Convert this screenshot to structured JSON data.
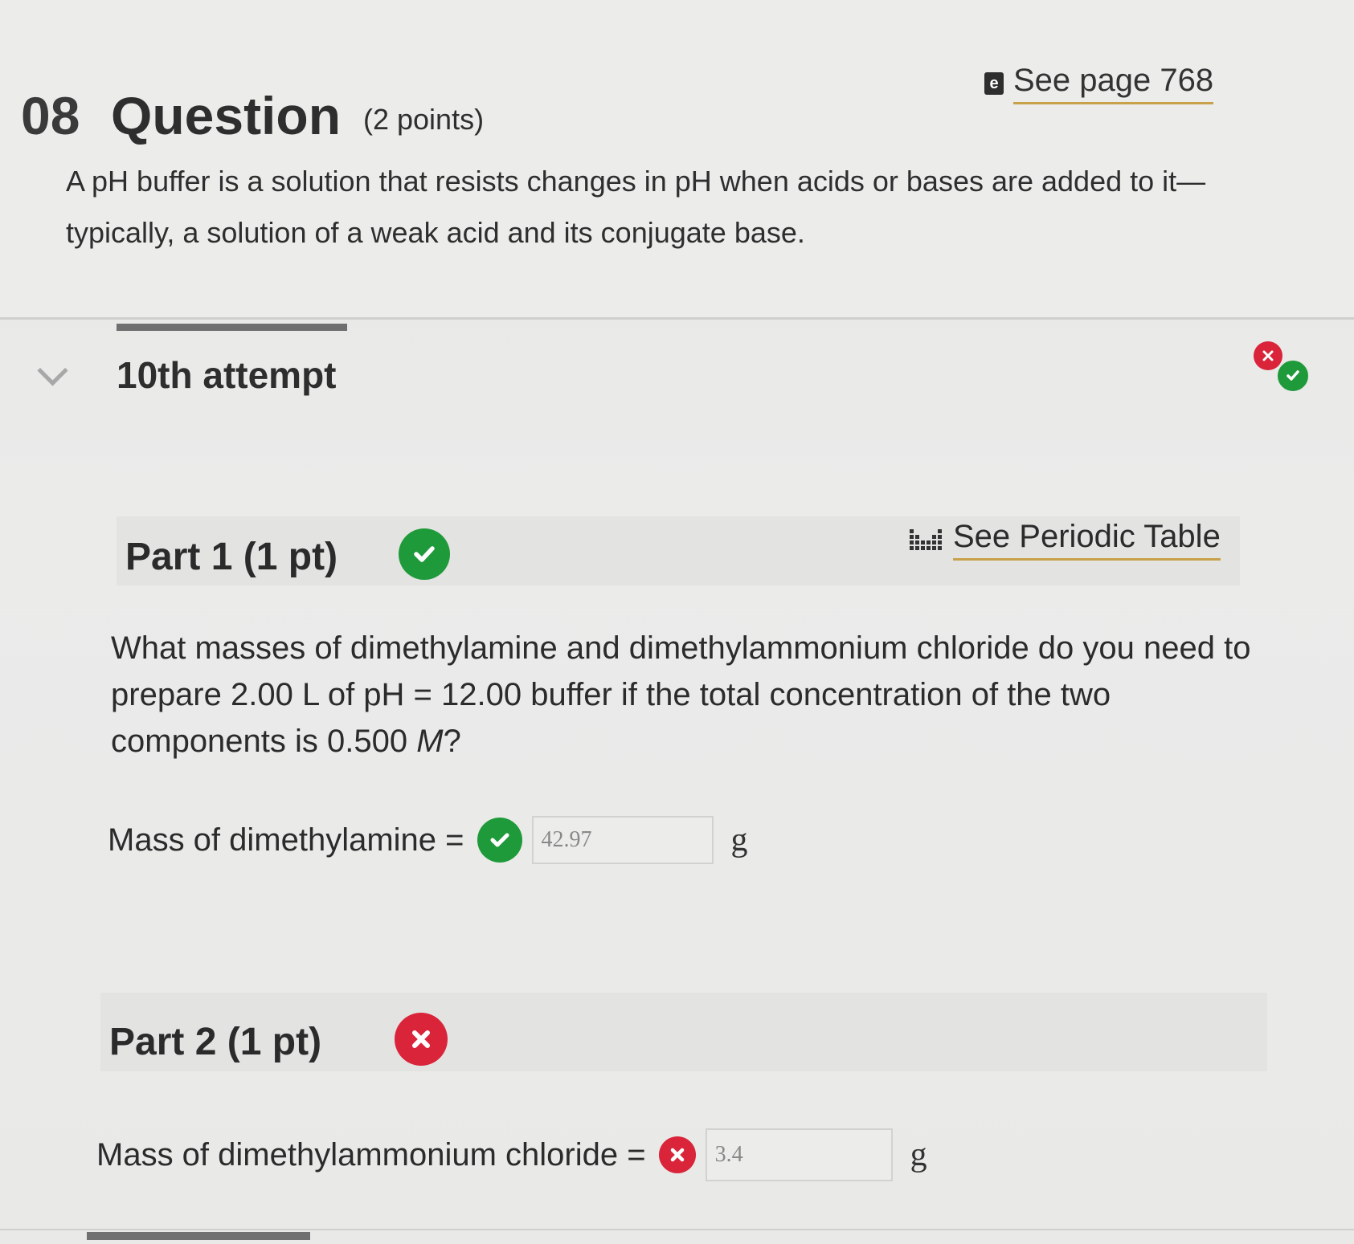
{
  "question": {
    "number": "08",
    "word": "Question",
    "points": "(2 points)",
    "see_page": "See page 768",
    "ebook_icon_glyph": "e",
    "intro_line1": "A pH buffer is a solution that resists changes in pH when acids or bases are added to it—",
    "intro_line2": "typically, a solution of a weak acid and its conjugate base."
  },
  "attempt": {
    "title": "10th attempt"
  },
  "part1": {
    "title": "Part 1 (1 pt)",
    "status": "correct",
    "periodic_table": "See Periodic Table",
    "prompt_line1": "What masses of dimethylamine and dimethylammonium chloride do you need to",
    "prompt_line2": "prepare 2.00 L of pH = 12.00 buffer if the total concentration of the two",
    "prompt_line3_start": "components is 0.500 ",
    "prompt_line3_italic": "M",
    "prompt_line3_end": "?",
    "answer_label": "Mass of dimethylamine =",
    "answer_value": "42.97",
    "unit": "g"
  },
  "part2": {
    "title": "Part 2 (1 pt)",
    "status": "incorrect",
    "answer_label": "Mass of dimethylammonium chloride =",
    "answer_value": "3.4",
    "unit": "g"
  },
  "colors": {
    "correct": "#1f9a3a",
    "incorrect": "#d9243a",
    "link_underline": "#c8a24b"
  }
}
